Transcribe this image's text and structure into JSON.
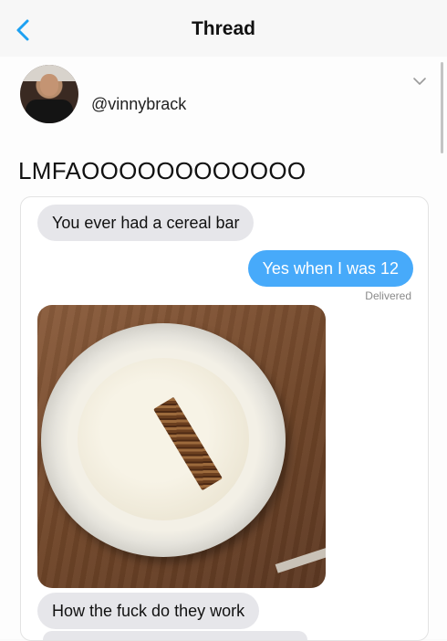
{
  "nav": {
    "title": "Thread",
    "back_icon": "chevron-left-icon"
  },
  "tweet": {
    "handle": "@vinnybrack",
    "text": "LMFAOOOOOOOOOOOO",
    "menu_icon": "chevron-down-icon"
  },
  "messages": {
    "first": "You ever had a cereal bar",
    "reply": "Yes when I was 12",
    "status": "Delivered",
    "last": "How the fuck do they work"
  },
  "colors": {
    "accent": "#1da1f2",
    "outgoing_bubble": "#47aafa",
    "incoming_bubble": "#e6e6ea"
  }
}
